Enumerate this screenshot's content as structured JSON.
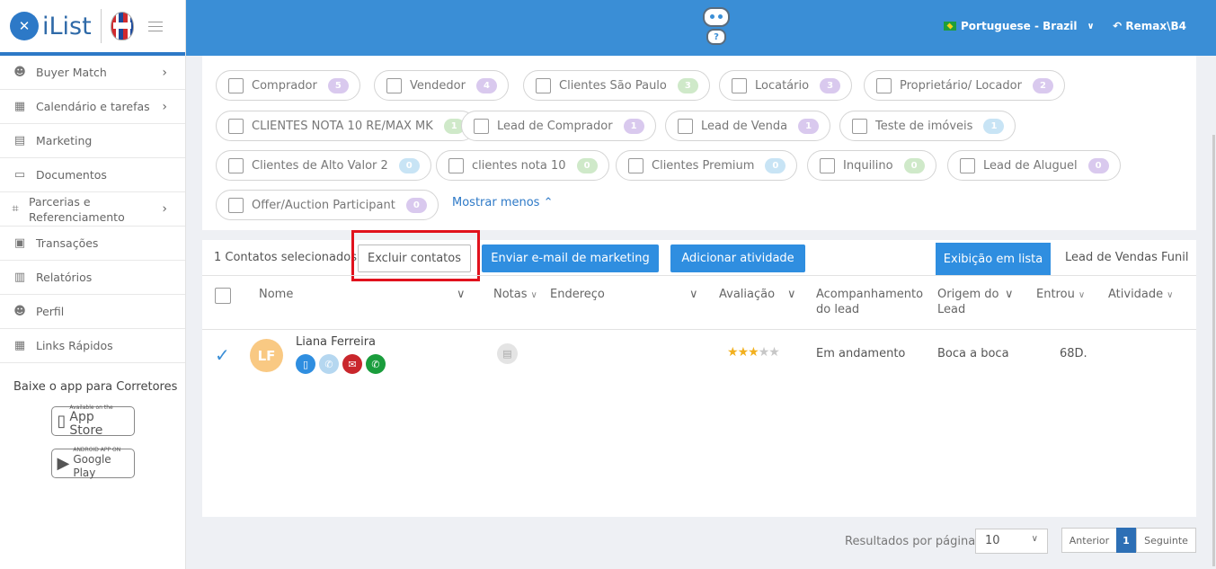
{
  "brand": {
    "logo_text": "iList"
  },
  "sidebar": {
    "items": [
      {
        "label": "Buyer Match",
        "icon": "user-icon",
        "chevron": true
      },
      {
        "label": "Calendário e tarefas",
        "icon": "calendar-icon",
        "chevron": true
      },
      {
        "label": "Marketing",
        "icon": "book-icon",
        "chevron": false
      },
      {
        "label": "Documentos",
        "icon": "folder-icon",
        "chevron": false
      },
      {
        "label": "Parcerias e Referenciamento",
        "icon": "handshake-icon",
        "chevron": true
      },
      {
        "label": "Transações",
        "icon": "briefcase-icon",
        "chevron": false
      },
      {
        "label": "Relatórios",
        "icon": "bar-chart-icon",
        "chevron": false
      },
      {
        "label": "Perfil",
        "icon": "user-icon",
        "chevron": false
      },
      {
        "label": "Links Rápidos",
        "icon": "building-icon",
        "chevron": false
      }
    ],
    "app_title": "Baixe o app para Corretores",
    "appstore_small": "Available on the",
    "appstore_big": "App Store",
    "googleplay_small": "ANDROID APP ON",
    "googleplay_big": "Google Play"
  },
  "header": {
    "language": "Portuguese - Brazil",
    "user": "Remax\\B4"
  },
  "filters": {
    "chips": [
      {
        "label": "Comprador",
        "count": "5",
        "color": "purple"
      },
      {
        "label": "Vendedor",
        "count": "4",
        "color": "purple"
      },
      {
        "label": "Clientes São Paulo",
        "count": "3",
        "color": "green"
      },
      {
        "label": "Locatário",
        "count": "3",
        "color": "purple"
      },
      {
        "label": "Proprietário/ Locador",
        "count": "2",
        "color": "purple"
      },
      {
        "label": "CLIENTES NOTA 10 RE/MAX MK",
        "count": "1",
        "color": "green"
      },
      {
        "label": "Lead de Comprador",
        "count": "1",
        "color": "purple"
      },
      {
        "label": "Lead de Venda",
        "count": "1",
        "color": "purple"
      },
      {
        "label": "Teste de imóveis",
        "count": "1",
        "color": "blue"
      },
      {
        "label": "Clientes de Alto Valor 2",
        "count": "0",
        "color": "blue"
      },
      {
        "label": "clientes nota 10",
        "count": "0",
        "color": "green"
      },
      {
        "label": "Clientes Premium",
        "count": "0",
        "color": "blue"
      },
      {
        "label": "Inquilino",
        "count": "0",
        "color": "green"
      },
      {
        "label": "Lead de Aluguel",
        "count": "0",
        "color": "purple"
      },
      {
        "label": "Offer/Auction Participant",
        "count": "0",
        "color": "purple"
      }
    ],
    "show_less": "Mostrar menos ⌃"
  },
  "toolbar": {
    "selected_text": "1 Contatos selecionados",
    "delete_label": "Excluir contatos",
    "email_label": "Enviar e-mail de marketing",
    "activity_label": "Adicionar atividade",
    "view_list_label": "Exibição em lista",
    "view_funnel_label": "Lead de Vendas Funil"
  },
  "table": {
    "headers": {
      "name": "Nome",
      "notes": "Notas",
      "address": "Endereço",
      "rating": "Avaliação",
      "followup": "Acompanhamento do lead",
      "origin": "Origem do Lead",
      "entered": "Entrou",
      "activity": "Atividade"
    },
    "rows": [
      {
        "initials": "LF",
        "name": "Liana Ferreira",
        "rating": 3,
        "rating_max": 5,
        "followup": "Em andamento",
        "origin": "Boca a boca",
        "entered": "68D."
      }
    ]
  },
  "pagination": {
    "per_page_label": "Resultados por página",
    "per_page_value": "10",
    "prev_label": "Anterior",
    "current_page": "1",
    "next_label": "Seguinte"
  },
  "colors": {
    "primary": "#2f8ee0",
    "header_bg": "#3a8ed6",
    "highlight_border": "#e1121d"
  }
}
